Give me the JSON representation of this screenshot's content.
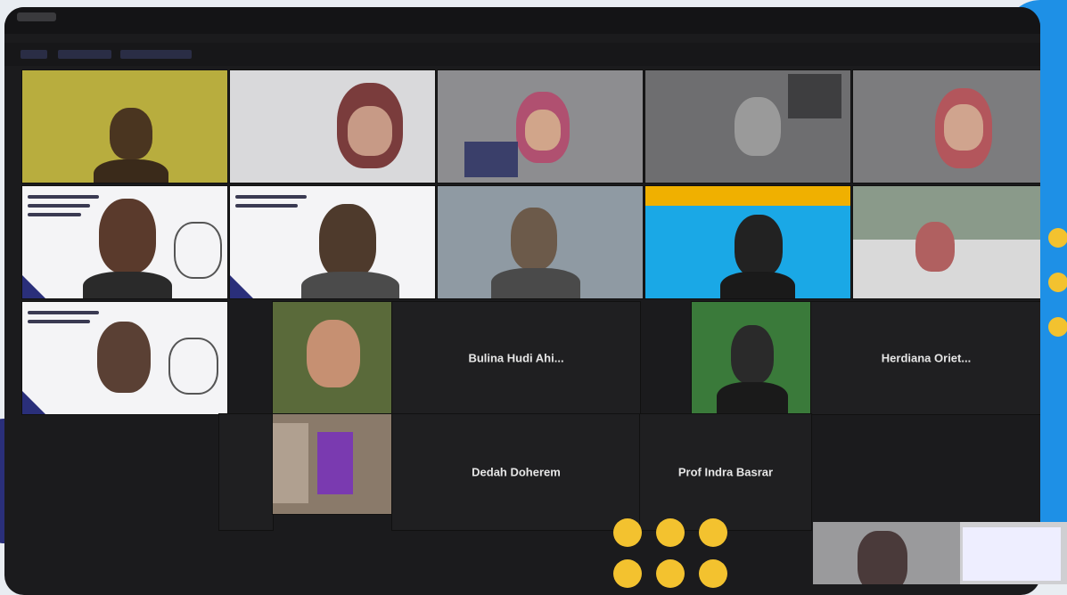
{
  "meeting": {
    "participants": [
      {
        "name": "Bulina Hudi Ahi..."
      },
      {
        "name": "Herdiana Oriet..."
      },
      {
        "name": "Dedah Doherem"
      },
      {
        "name": "Prof Indra Basrar"
      }
    ]
  },
  "colors": {
    "window_bg": "#1b1b1d",
    "accent_blue": "#1e90e6",
    "accent_navy": "#2a2f7a",
    "dot_yellow": "#f3c22f"
  }
}
